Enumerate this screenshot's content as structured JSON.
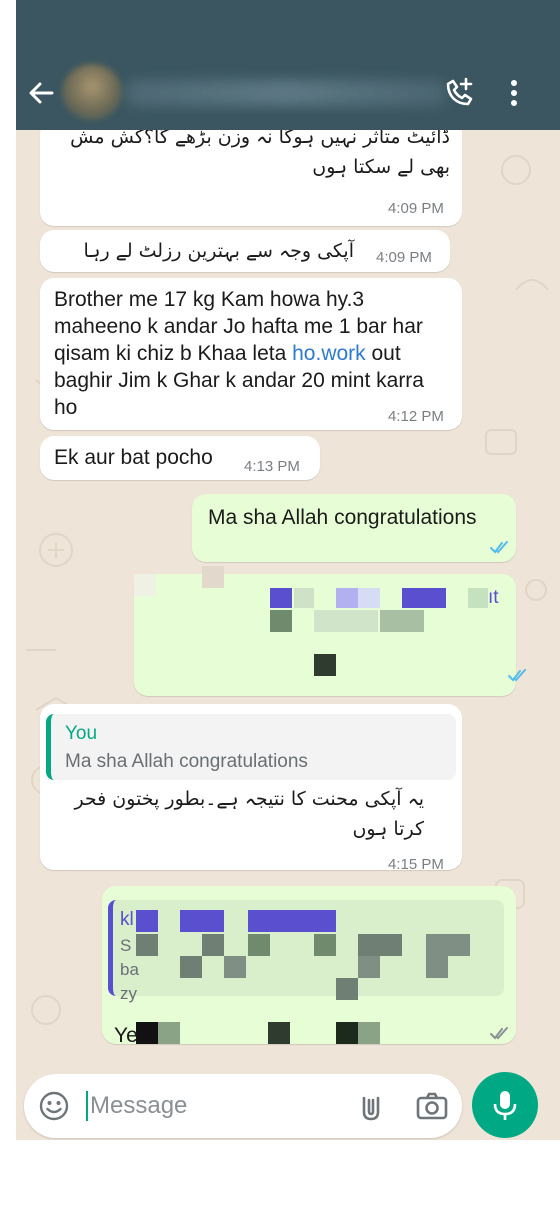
{
  "header": {
    "back_label": "Back",
    "contact_name": "",
    "background_color": "#3b5660"
  },
  "messages": [
    {
      "id": "m1",
      "direction": "incoming",
      "text": "ڈائیٹ متاثر نہیں ہوگا نہ وزن بڑھے گا؟کش مش بھی لے سکتا ہوں",
      "time": "4:09 PM"
    },
    {
      "id": "m2",
      "direction": "incoming",
      "text": "آپکی وجہ سے بہترین رزلٹ لے رہا ہوں",
      "time": "4:09 PM"
    },
    {
      "id": "m3",
      "direction": "incoming",
      "text_before_link": "Brother me 17 kg Kam howa hy.3 maheeno k andar Jo hafta me 1 bar har qisam ki chiz b Khaa leta ",
      "link": "ho.work",
      "text_after_link": " out baghir Jim k Ghar k andar 20 mint karra ho",
      "time": "4:12 PM"
    },
    {
      "id": "m4",
      "direction": "incoming",
      "text": "Ek aur bat pocho",
      "time": "4:13 PM"
    },
    {
      "id": "m5",
      "direction": "outgoing",
      "text": "Ma sha Allah congratulations",
      "status": "read"
    },
    {
      "id": "m6",
      "direction": "outgoing",
      "text": "redacted",
      "visible_fragment": "ıt",
      "status": "read"
    },
    {
      "id": "m7",
      "direction": "incoming",
      "quote_author": "You",
      "quote_text": "Ma sha Allah congratulations",
      "text": "یہ آپکی محنت کا نتیجہ ہے۔بطور پختون فحر کرتا ہوں",
      "time": "4:15 PM"
    },
    {
      "id": "m8",
      "direction": "outgoing",
      "quote_fragments": [
        "kl",
        "S",
        "ba",
        "zy"
      ],
      "text_fragment": "Ye",
      "status": "read"
    }
  ],
  "composer": {
    "placeholder": "Message",
    "value": ""
  },
  "colors": {
    "accent": "#00a884",
    "incoming_bubble": "#ffffff",
    "outgoing_bubble": "#e7fdd5",
    "chat_background": "#eee4d8",
    "read_ticks": "#53bdeb",
    "link": "#2c7bd0"
  },
  "icons": [
    "back-arrow-icon",
    "add-call-icon",
    "more-vert-icon",
    "emoji-icon",
    "attach-icon",
    "camera-icon",
    "mic-icon",
    "double-check-icon"
  ]
}
